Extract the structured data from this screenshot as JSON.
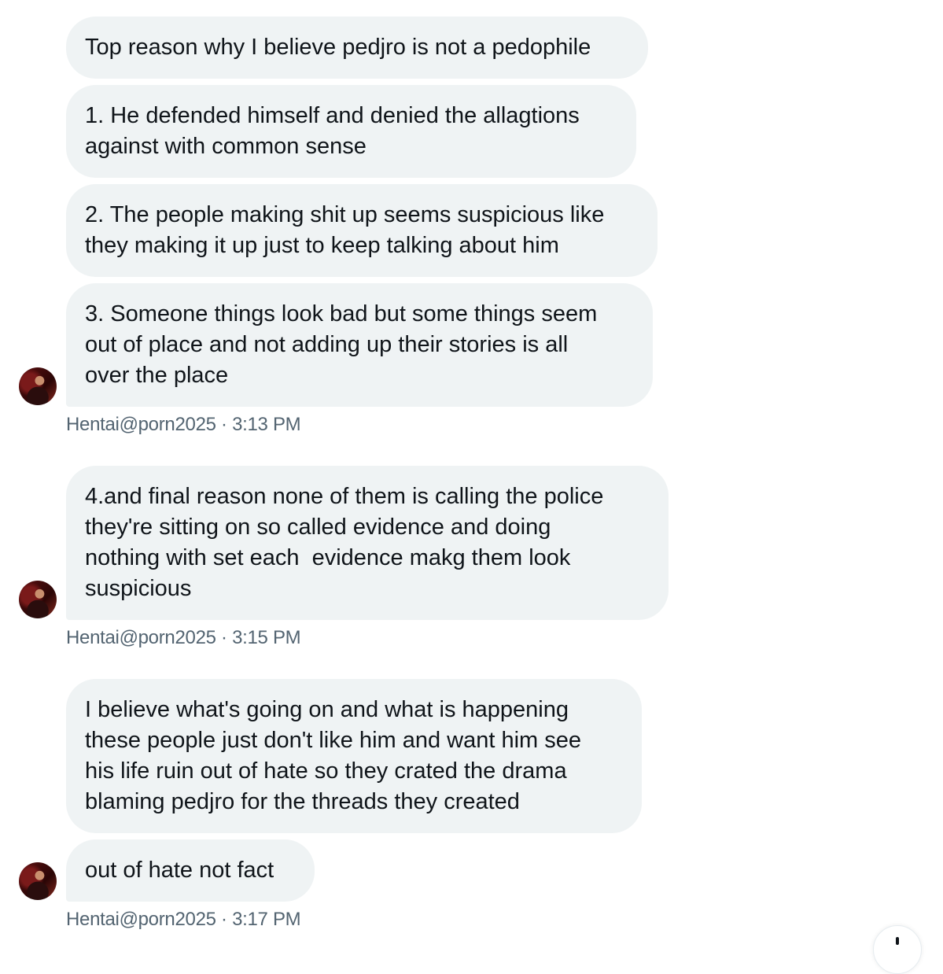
{
  "messages": [
    {
      "text": "Top reason why I believe pedjro is not a pedophile"
    },
    {
      "text": "1. He defended himself and denied the allagtions\nagainst with common sense"
    },
    {
      "text": "2. The people making shit up seems suspicious like\nthey making it up just to keep talking about him"
    },
    {
      "text": "3. Someone things look bad but some things seem\nout of place and not adding up their stories is all\nover the place"
    },
    {
      "text": "4.and final reason none of them is calling the police\nthey're sitting on so called evidence and doing\nnothing with set each  evidence makg them look\nsuspicious"
    },
    {
      "text": "I believe what's going on and what is happening\nthese people just don't like him and want him see\nhis life ruin out of hate so they crated the drama\nblaming pedjro for the threads they created"
    },
    {
      "text": "out of hate not fact"
    }
  ],
  "meta": [
    {
      "text": "Hentai@porn2025 · 3:13 PM"
    },
    {
      "text": "Hentai@porn2025 · 3:15 PM"
    },
    {
      "text": "Hentai@porn2025 · 3:17 PM"
    }
  ],
  "icons": {
    "avatar": "user-avatar",
    "scroll": "scroll-down-button"
  }
}
